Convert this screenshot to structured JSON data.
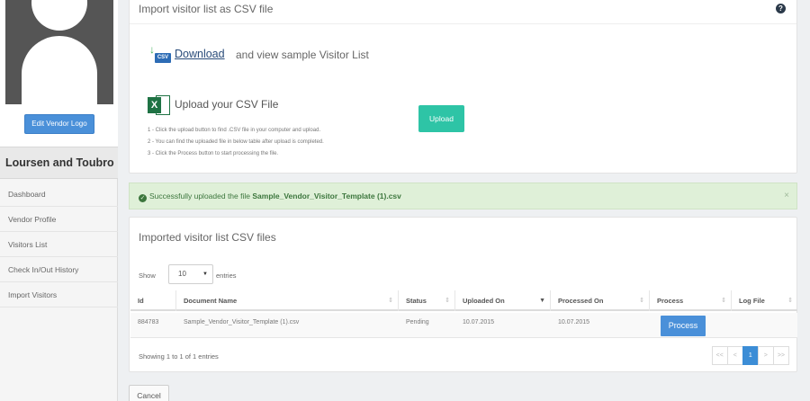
{
  "sidebar": {
    "edit_logo_label": "Edit Vendor Logo",
    "company_name": "Loursen and Toubro",
    "nav_items": [
      {
        "label": "Dashboard"
      },
      {
        "label": "Vendor Profile"
      },
      {
        "label": "Visitors List"
      },
      {
        "label": "Check In/Out History"
      },
      {
        "label": "Import Visitors"
      }
    ]
  },
  "import_panel": {
    "title": "Import visitor list as CSV file",
    "help_glyph": "?",
    "download_link": "Download",
    "download_text": "and view sample Visitor List",
    "upload_title": "Upload your CSV File",
    "upload_button": "Upload",
    "instructions": [
      "1 - Click the upload button to find .CSV file in your computer and upload.",
      "2 - You can find the uploaded file in below table after upload is completed.",
      "3 - Click the Process button to start processing the file."
    ]
  },
  "alert": {
    "message": "Successfully uploaded the file",
    "file_name": "Sample_Vendor_Visitor_Template (1).csv",
    "close_glyph": "×"
  },
  "files_panel": {
    "title": "Imported visitor list CSV files",
    "show_label": "Show",
    "page_size": "10",
    "entries_label": "entries",
    "columns": [
      "Id",
      "Document Name",
      "Status",
      "Uploaded On",
      "Processed On",
      "Process",
      "Log File"
    ],
    "rows": [
      {
        "id": "884783",
        "document_name": "Sample_Vendor_Visitor_Template (1).csv",
        "status": "Pending",
        "uploaded_on": "10.07.2015",
        "processed_on": "10.07.2015",
        "process_button": "Process"
      }
    ],
    "showing_text": "Showing 1 to 1 of 1 entries",
    "pagination": [
      "<<",
      "<",
      "1",
      ">",
      ">>"
    ],
    "active_page": "1"
  },
  "cancel_button": "Cancel"
}
